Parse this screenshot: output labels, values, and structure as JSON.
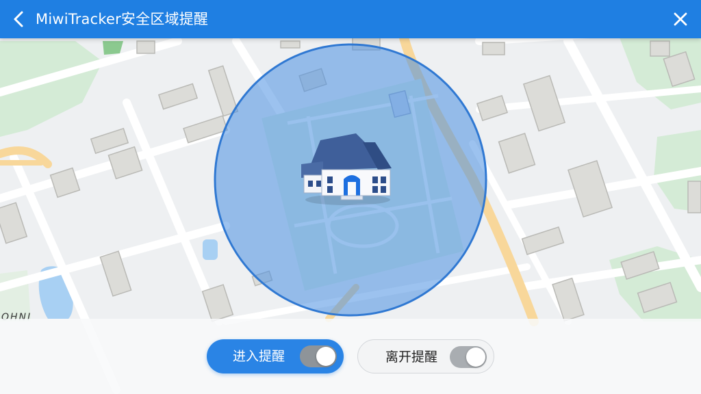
{
  "titlebar": {
    "title": "MiwiTracker安全区域提醒",
    "back_icon": "chevron-left-icon",
    "close_icon": "close-icon",
    "color": "#1f7fe2"
  },
  "map": {
    "label": "OHNI",
    "marker_icon": "school-building-icon",
    "zone_fill": "#4a90e2",
    "zone_stroke": "#2f78d2"
  },
  "toggles": {
    "enter": {
      "label": "进入提醒",
      "on": true,
      "color": "#2a84e5"
    },
    "leave": {
      "label": "离开提醒",
      "on": true,
      "color": "#f3f4f5"
    }
  }
}
